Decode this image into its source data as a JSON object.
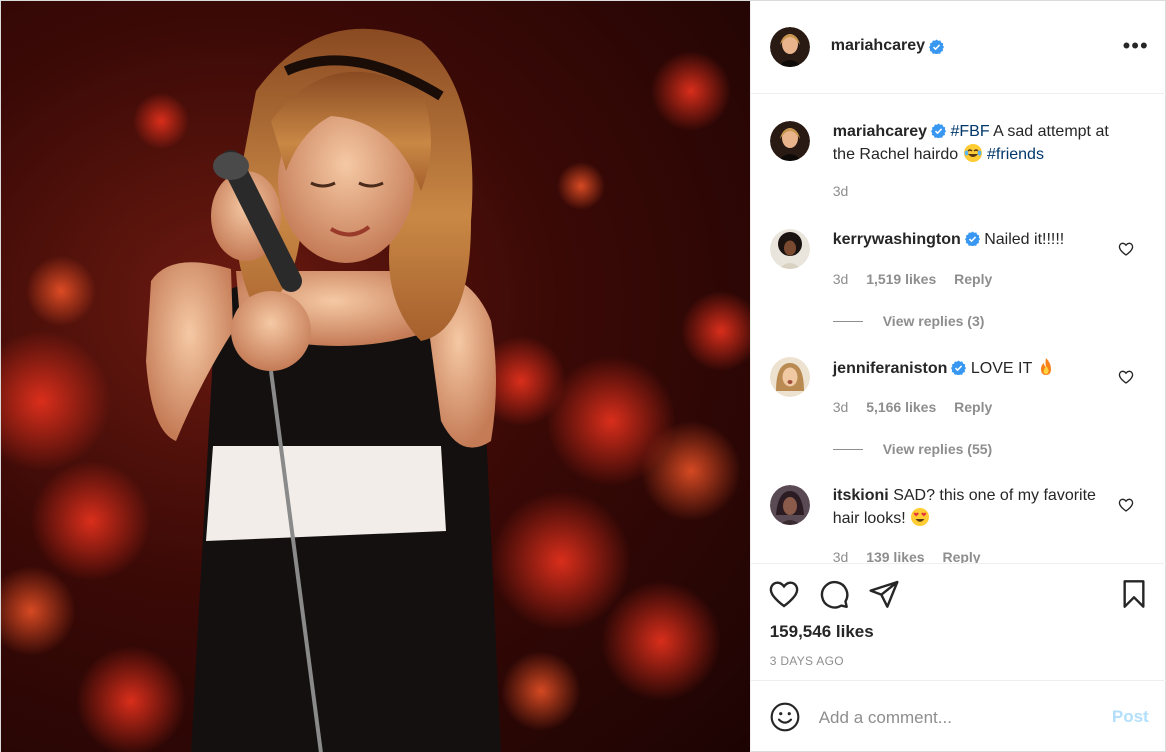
{
  "post": {
    "author": "mariahcarey",
    "verified": true,
    "more_icon": "ellipsis-icon"
  },
  "caption": {
    "username": "mariahcarey",
    "hashtag1": "#FBF",
    "text": " A sad attempt at the Rachel hairdo ",
    "emoji": "joy-emoji",
    "hashtag2": "#friends",
    "time": "3d"
  },
  "comments": [
    {
      "username": "kerrywashington",
      "verified": true,
      "text": "Nailed it!!!!!",
      "time": "3d",
      "likes": "1,519 likes",
      "reply": "Reply",
      "view_replies": "View replies (3)"
    },
    {
      "username": "jenniferaniston",
      "verified": true,
      "text": "LOVE IT ",
      "emoji": "fire-emoji",
      "time": "3d",
      "likes": "5,166 likes",
      "reply": "Reply",
      "view_replies": "View replies (55)"
    },
    {
      "username": "itskioni",
      "verified": false,
      "text": "SAD? this one of my favorite hair looks! ",
      "emoji": "heart-eyes-emoji",
      "time": "3d",
      "likes": "139 likes",
      "reply": "Reply"
    }
  ],
  "actions": {
    "like_icon": "heart-icon",
    "comment_icon": "comment-icon",
    "share_icon": "paper-plane-icon",
    "save_icon": "bookmark-icon",
    "likes": "159,546 likes",
    "posted": "3 DAYS AGO"
  },
  "add_comment": {
    "placeholder": "Add a comment...",
    "post_label": "Post",
    "emoji_icon": "smiley-icon"
  },
  "colors": {
    "verified": "#3897f0",
    "hashtag": "#00376b",
    "secondary_text": "#8e8e8e",
    "post_button_disabled": "#b2dffc"
  }
}
